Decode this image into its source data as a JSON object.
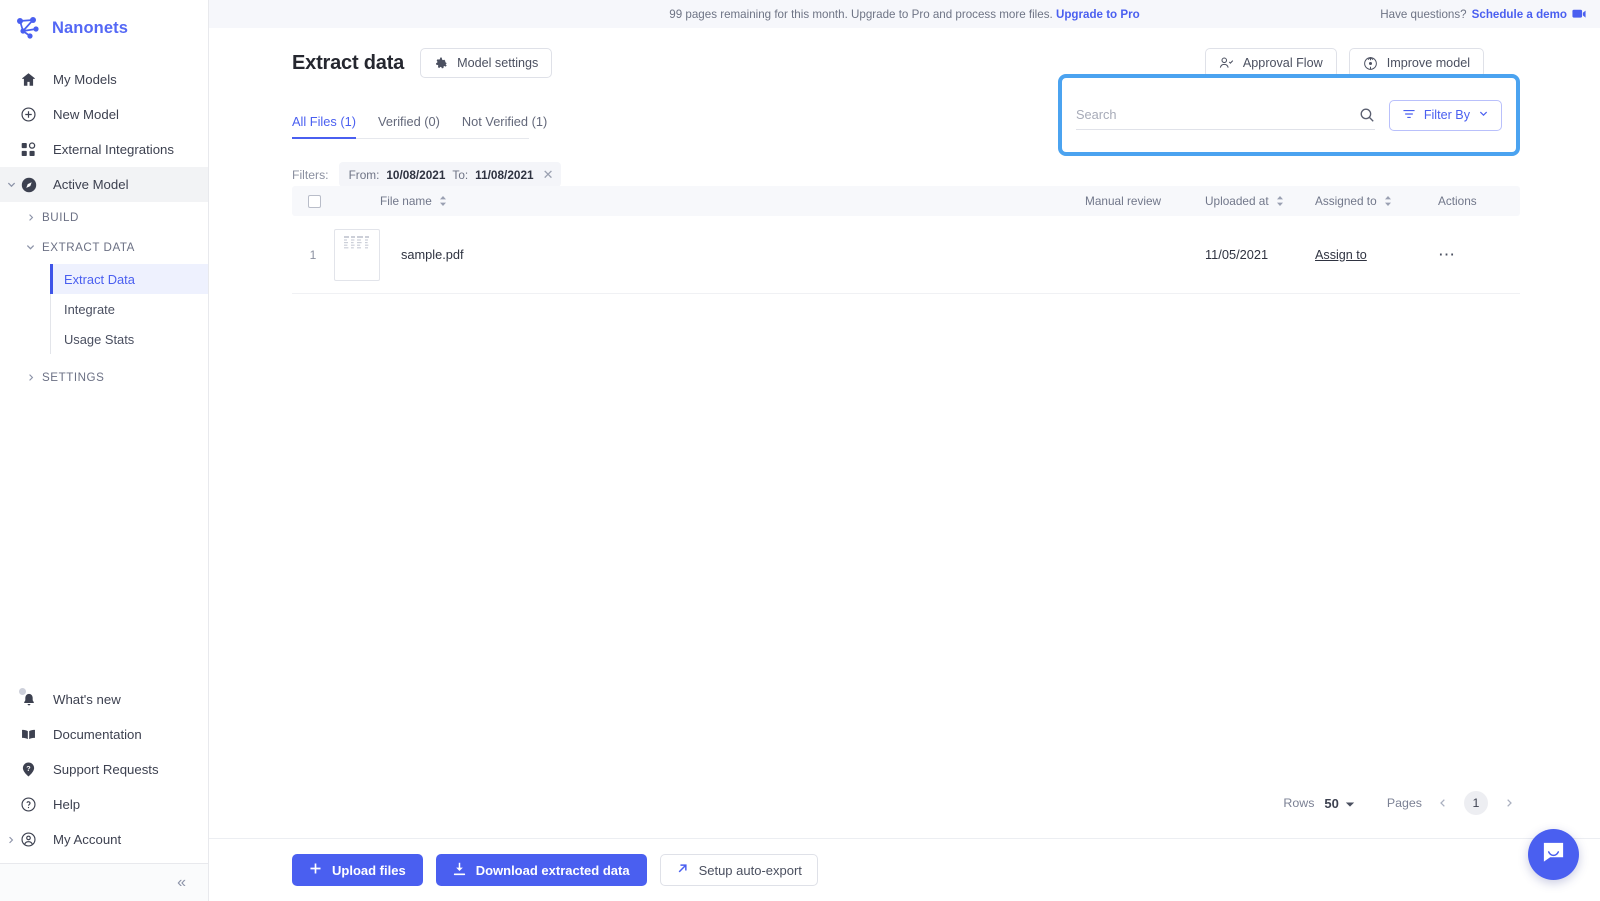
{
  "brand": {
    "name": "Nanonets",
    "logo_icon": "nanonets-network-logo"
  },
  "banner": {
    "text": "99 pages remaining for this month. Upgrade to Pro and process more files.",
    "cta": "Upgrade to Pro",
    "right_text": "Have questions?",
    "right_cta": "Schedule a demo",
    "right_icon": "chat-demo-icon"
  },
  "sidebar": {
    "items": [
      {
        "label": "My Models",
        "icon": "home-icon"
      },
      {
        "label": "New Model",
        "icon": "plus-circle-icon"
      },
      {
        "label": "External Integrations",
        "icon": "grid-apps-icon"
      },
      {
        "label": "Active Model",
        "icon": "compass-icon",
        "expanded": true
      }
    ],
    "sections": [
      {
        "label": "BUILD",
        "expanded": false,
        "children": []
      },
      {
        "label": "EXTRACT DATA",
        "expanded": true,
        "children": [
          {
            "label": "Extract Data",
            "selected": true
          },
          {
            "label": "Integrate",
            "selected": false
          },
          {
            "label": "Usage Stats",
            "selected": false
          }
        ]
      },
      {
        "label": "SETTINGS",
        "expanded": false,
        "children": []
      }
    ],
    "bottom_items": [
      {
        "label": "What's new",
        "icon": "bell-icon",
        "badge": true
      },
      {
        "label": "Documentation",
        "icon": "book-icon"
      },
      {
        "label": "Support Requests",
        "icon": "question-pin-icon"
      },
      {
        "label": "Help",
        "icon": "question-circle-icon"
      },
      {
        "label": "My Account",
        "icon": "user-circle-icon"
      }
    ],
    "collapse_icon": "double-chevron-left-icon"
  },
  "header": {
    "title": "Extract data",
    "model_settings": "Model settings",
    "model_settings_icon": "gear-icon",
    "approval_flow": "Approval Flow",
    "approval_flow_icon": "user-check-icon",
    "improve_model": "Improve model",
    "improve_model_icon": "target-improve-icon"
  },
  "tabs": [
    {
      "label": "All Files (1)",
      "active": true
    },
    {
      "label": "Verified (0)",
      "active": false
    },
    {
      "label": "Not Verified (1)",
      "active": false
    }
  ],
  "search": {
    "value": "",
    "placeholder": "Search",
    "search_icon": "search-icon",
    "filter_label": "Filter By",
    "filter_icon": "filter-lines-icon",
    "filter_caret_icon": "chevron-down-icon",
    "highlight_color": "#4ba3f0"
  },
  "filters": {
    "label": "Filters:",
    "chip_from_label": "From:",
    "chip_from_value": "10/08/2021",
    "chip_to_label": "To:",
    "chip_to_value": "11/08/2021",
    "chip_close_icon": "close-icon"
  },
  "table": {
    "columns": [
      {
        "label": "File name",
        "sortable": true
      },
      {
        "label": "Manual review",
        "sortable": false
      },
      {
        "label": "Uploaded at",
        "sortable": true
      },
      {
        "label": "Assigned to",
        "sortable": true
      },
      {
        "label": "Actions",
        "sortable": false
      }
    ],
    "rows": [
      {
        "index": "1",
        "file_name": "sample.pdf",
        "manual_review": "",
        "uploaded_at": "11/05/2021",
        "assigned_to": "Assign to",
        "actions_icon": "more-horizontal-icon"
      }
    ]
  },
  "pagination": {
    "rows_label": "Rows",
    "rows_value": "50",
    "rows_caret_icon": "chevron-down-icon",
    "pages_label": "Pages",
    "prev_icon": "chevron-left-icon",
    "next_icon": "chevron-right-icon",
    "current_page": "1"
  },
  "footer": {
    "upload": "Upload files",
    "upload_icon": "plus-icon",
    "download": "Download extracted data",
    "download_icon": "download-icon",
    "autoexport": "Setup auto-export",
    "autoexport_icon": "arrow-up-right-icon"
  },
  "chat": {
    "icon": "chat-bubble-icon",
    "color": "#4a5ff0"
  }
}
